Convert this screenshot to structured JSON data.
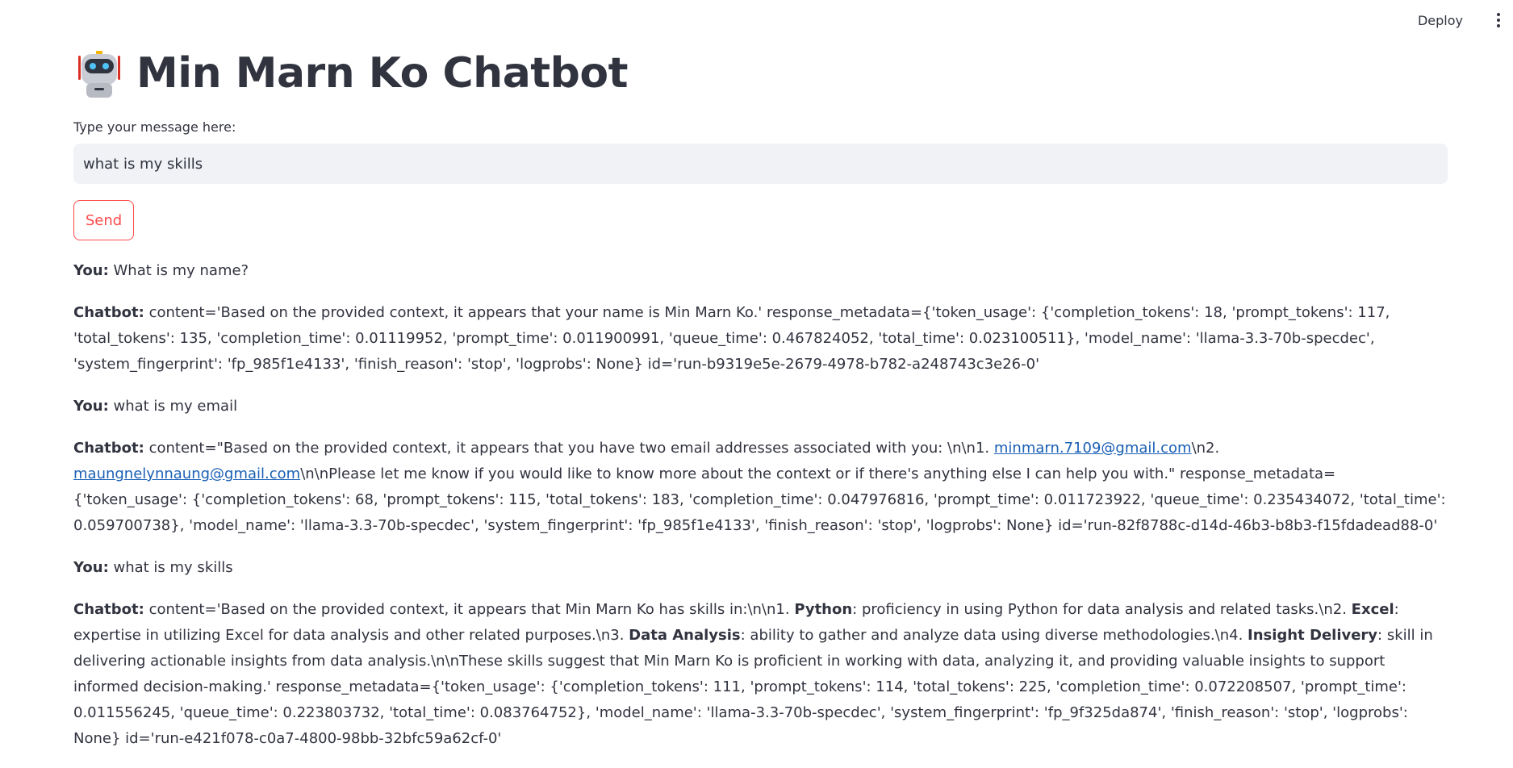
{
  "header": {
    "deploy_label": "Deploy",
    "menu_icon": "kebab-menu-icon"
  },
  "app": {
    "title": "Min Marn Ko Chatbot",
    "title_icon": "robot-icon"
  },
  "input": {
    "label": "Type your message here:",
    "value": "what is my skills"
  },
  "send_button": {
    "label": "Send"
  },
  "colors": {
    "accent": "#ff4b4b",
    "input_bg": "#f0f2f6",
    "text": "#31333f",
    "link": "#1a5fb4"
  },
  "messages": [
    {
      "speaker": "You:",
      "text": " What is my name?"
    },
    {
      "speaker": "Chatbot:",
      "text": " content='Based on the provided context, it appears that your name is Min Marn Ko.' response_metadata={'token_usage': {'completion_tokens': 18, 'prompt_tokens': 117, 'total_tokens': 135, 'completion_time': 0.01119952, 'prompt_time': 0.011900991, 'queue_time': 0.467824052, 'total_time': 0.023100511}, 'model_name': 'llama-3.3-70b-specdec', 'system_fingerprint': 'fp_985f1e4133', 'finish_reason': 'stop', 'logprobs': None} id='run-b9319e5e-2679-4978-b782-a248743c3e26-0'"
    },
    {
      "speaker": "You:",
      "text": " what is my email"
    },
    {
      "speaker": "Chatbot:",
      "text_before": " content=\"Based on the provided context, it appears that you have two email addresses associated with you: \\n\\n1. ",
      "email1": "minmarn.7109@gmail.com",
      "text_mid": "\\n2. ",
      "email2": "maungnelynnaung@gmail.com",
      "text_after": "\\n\\nPlease let me know if you would like to know more about the context or if there's anything else I can help you with.\" response_metadata={'token_usage': {'completion_tokens': 68, 'prompt_tokens': 115, 'total_tokens': 183, 'completion_time': 0.047976816, 'prompt_time': 0.011723922, 'queue_time': 0.235434072, 'total_time': 0.059700738}, 'model_name': 'llama-3.3-70b-specdec', 'system_fingerprint': 'fp_985f1e4133', 'finish_reason': 'stop', 'logprobs': None} id='run-82f8788c-d14d-46b3-b8b3-f15fdadead88-0'"
    },
    {
      "speaker": "You:",
      "text": " what is my skills"
    },
    {
      "speaker": "Chatbot:",
      "p1": " content='Based on the provided context, it appears that Min Marn Ko has skills in:\\n\\n1. ",
      "b1": "Python",
      "p2": ": proficiency in using Python for data analysis and related tasks.\\n2. ",
      "b2": "Excel",
      "p3": ": expertise in utilizing Excel for data analysis and other related purposes.\\n3. ",
      "b3": "Data Analysis",
      "p4": ": ability to gather and analyze data using diverse methodologies.\\n4. ",
      "b4": "Insight Delivery",
      "p5": ": skill in delivering actionable insights from data analysis.\\n\\nThese skills suggest that Min Marn Ko is proficient in working with data, analyzing it, and providing valuable insights to support informed decision-making.' response_metadata={'token_usage': {'completion_tokens': 111, 'prompt_tokens': 114, 'total_tokens': 225, 'completion_time': 0.072208507, 'prompt_time': 0.011556245, 'queue_time': 0.223803732, 'total_time': 0.083764752}, 'model_name': 'llama-3.3-70b-specdec', 'system_fingerprint': 'fp_9f325da874', 'finish_reason': 'stop', 'logprobs': None} id='run-e421f078-c0a7-4800-98bb-32bfc59a62cf-0'"
    }
  ]
}
